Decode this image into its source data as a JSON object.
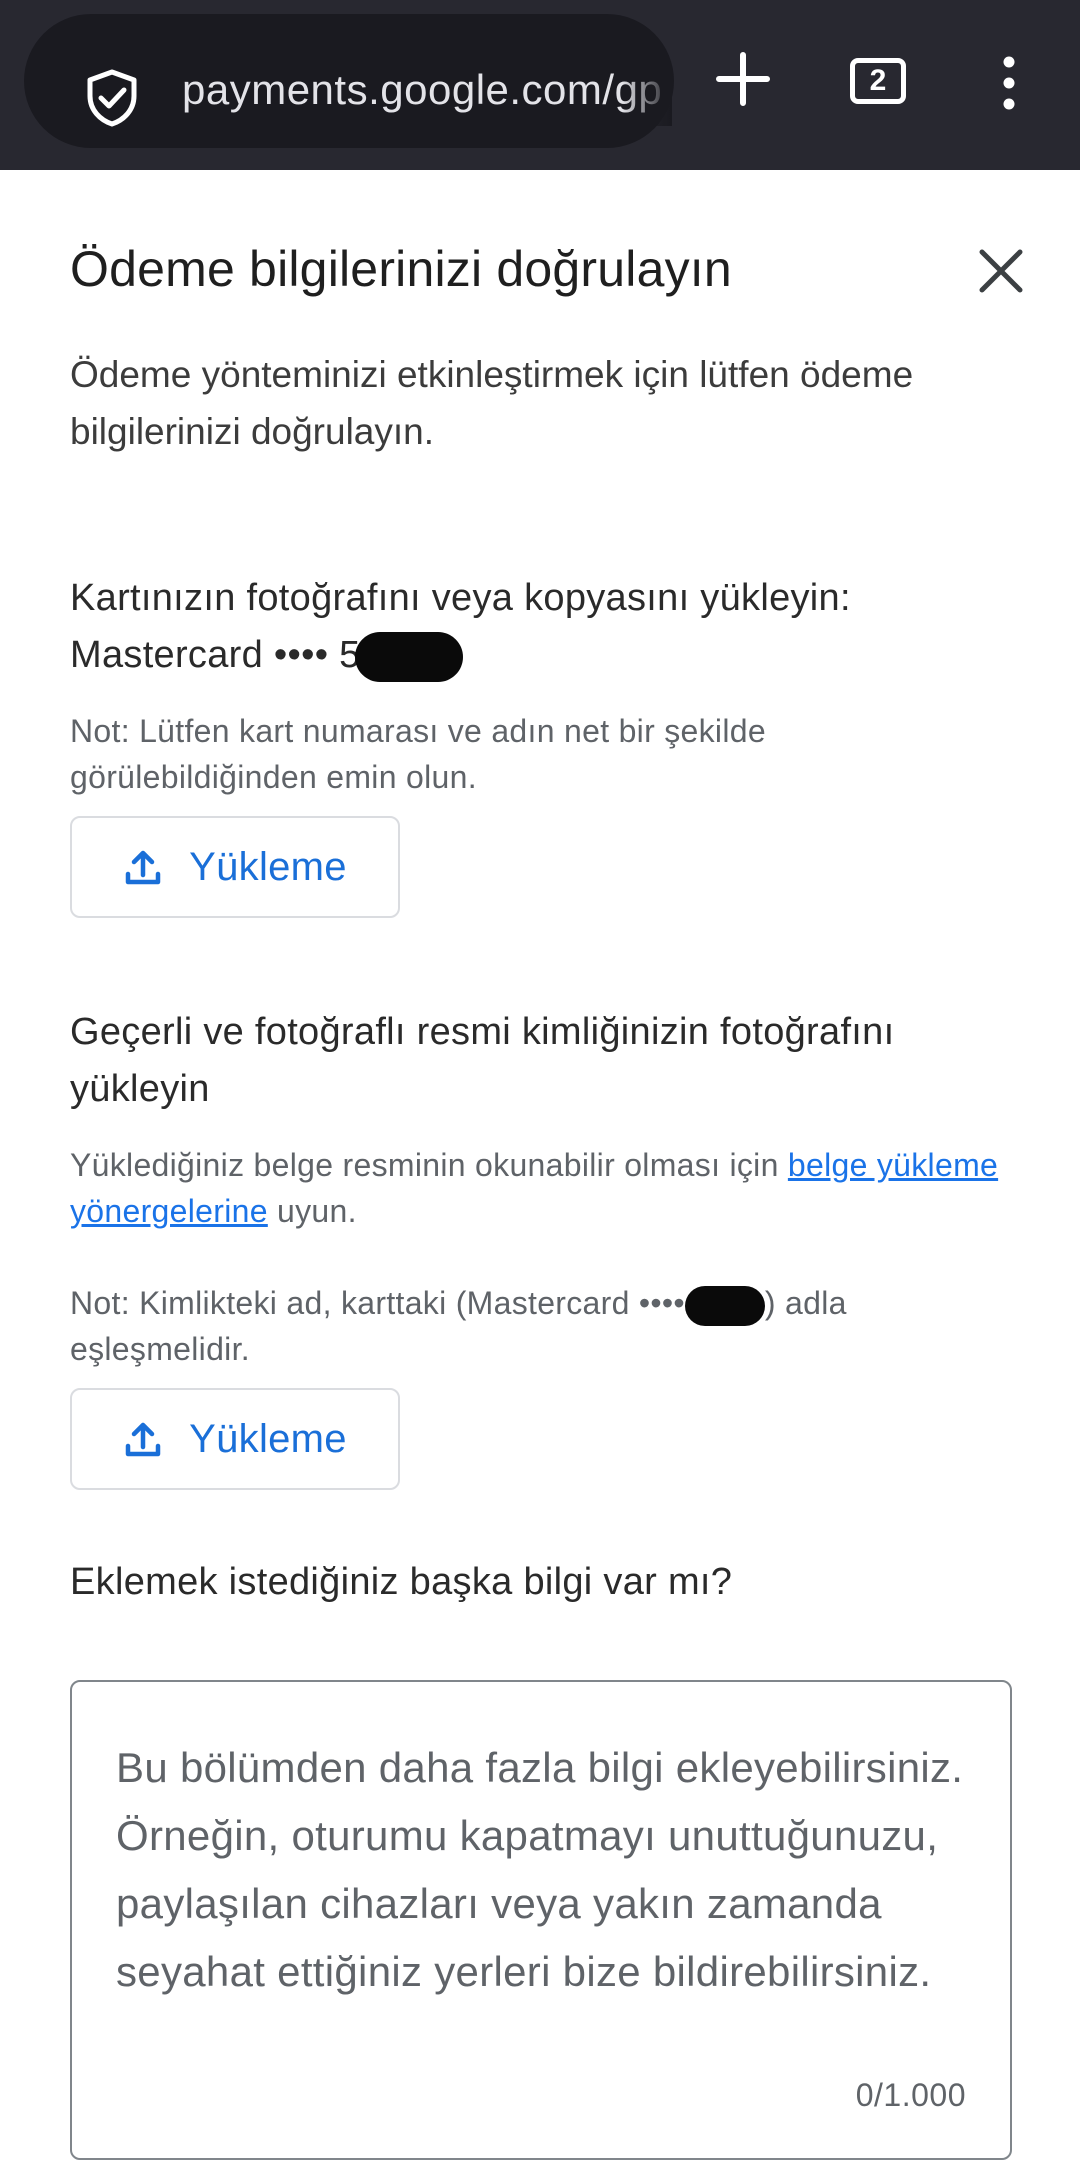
{
  "browser": {
    "url": "payments.google.com/gp",
    "tab_count": "2"
  },
  "dialog": {
    "title": "Ödeme bilgilerinizi doğrulayın",
    "intro": "Ödeme yönteminizi etkinleştirmek için lütfen ödeme bilgilerinizi doğrulayın."
  },
  "card_section": {
    "heading_line1": "Kartınızın fotoğrafını veya kopyasını yükleyin:",
    "heading_line2": "Mastercard •••• 5",
    "note": "Not: Lütfen kart numarası ve adın net bir şekilde görülebildiğinden emin olun.",
    "upload_label": "Yükleme"
  },
  "id_section": {
    "heading": "Geçerli ve fotoğraflı resmi kimliğinizin fotoğrafını yükleyin",
    "guide_prefix": "Yüklediğiniz belge resminin okunabilir olması için ",
    "guide_link": "belge yükleme yönergelerine",
    "guide_suffix": " uyun.",
    "note_prefix": "Not: Kimlikteki ad, karttaki (Mastercard ••••",
    "note_suffix": ") adla eşleşmelidir.",
    "upload_label": "Yükleme"
  },
  "extra_section": {
    "heading": "Eklemek istediğiniz başka bilgi var mı?",
    "placeholder": "Bu bölümden daha fazla bilgi ekleyebilirsiniz. Örneğin, oturumu kapatmayı unuttuğunuzu, paylaşılan cihazları veya yakın zamanda seyahat ettiğiniz yerleri bize bildirebilirsiniz.",
    "counter": "0/1.000"
  },
  "colors": {
    "chrome_bg": "#282830",
    "accent": "#1a73e8"
  },
  "icons": [
    "shield-check-icon",
    "plus-icon",
    "tabs-icon",
    "more-vert-icon",
    "close-icon",
    "upload-icon"
  ]
}
